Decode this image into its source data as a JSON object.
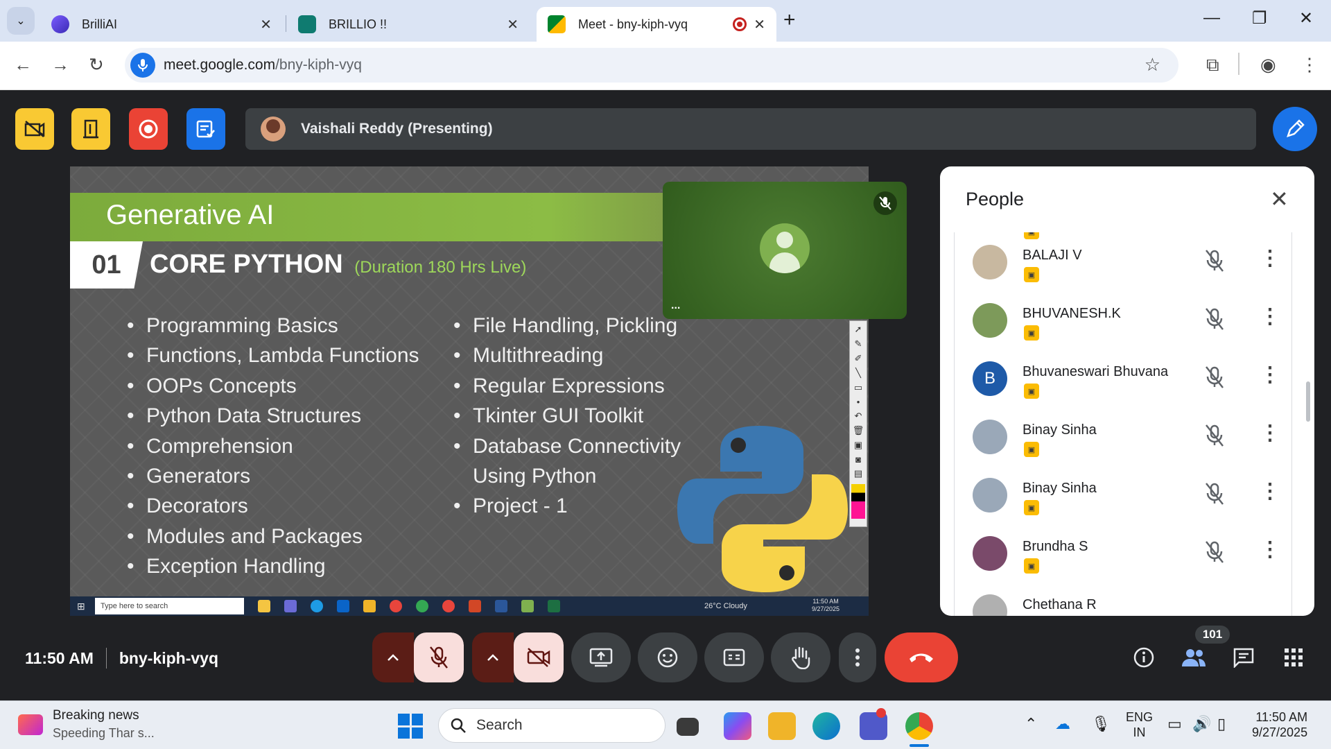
{
  "browser": {
    "tabs": [
      {
        "title": "BrilliAI",
        "active": false
      },
      {
        "title": "BRILLIO !!",
        "active": false
      },
      {
        "title": "Meet - bny-kiph-vyq",
        "active": true
      }
    ],
    "url_host": "meet.google.com",
    "url_path": "/bny-kiph-vyq"
  },
  "meet": {
    "presenter_label": "Vaishali Reddy (Presenting)",
    "time": "11:50 AM",
    "meeting_code": "bny-kiph-vyq",
    "participant_count": "101",
    "self_tile_more": "..."
  },
  "slide": {
    "title": "Generative AI",
    "number": "01",
    "heading": "CORE PYTHON",
    "duration": "(Duration 180 Hrs Live)",
    "left_bullets": [
      "Programming Basics",
      "Functions, Lambda Functions",
      "OOPs Concepts",
      "Python Data Structures",
      "Comprehension",
      "Generators",
      "Decorators",
      "Modules and Packages",
      "Exception Handling"
    ],
    "right_bullets": [
      "File Handling, Pickling",
      "Multithreading",
      "Regular Expressions",
      "Tkinter GUI Toolkit",
      "Database Connectivity",
      "Using Python",
      "Project - 1"
    ],
    "shared_taskbar": {
      "search_placeholder": "Type here to search",
      "weather": "26°C  Cloudy",
      "time": "11:50 AM",
      "date": "9/27/2025"
    }
  },
  "people_panel": {
    "title": "People",
    "participants": [
      {
        "name": "BALAJI V",
        "avatar_color": "#c8b8a0",
        "initial": ""
      },
      {
        "name": "BHUVANESH.K",
        "avatar_color": "#7d9a5a",
        "initial": ""
      },
      {
        "name": "Bhuvaneswari Bhuvana",
        "avatar_color": "#1e5aa8",
        "initial": "B"
      },
      {
        "name": "Binay Sinha",
        "avatar_color": "#9aa8b8",
        "initial": ""
      },
      {
        "name": "Binay Sinha",
        "avatar_color": "#9aa8b8",
        "initial": ""
      },
      {
        "name": "Brundha S",
        "avatar_color": "#7a4a6a",
        "initial": ""
      },
      {
        "name": "Chethana R",
        "avatar_color": "#b0b0b0",
        "initial": ""
      }
    ]
  },
  "taskbar": {
    "news_headline": "Breaking news",
    "news_sub": "Speeding Thar s...",
    "search_label": "Search",
    "lang_top": "ENG",
    "lang_bottom": "IN",
    "time": "11:50 AM",
    "date": "9/27/2025"
  },
  "colors": {
    "meet_bg": "#202124",
    "presenter_bar": "#3c4043",
    "accent_blue": "#1a73e8",
    "end_call_red": "#ea4335",
    "slide_green": "#8cbc45"
  }
}
